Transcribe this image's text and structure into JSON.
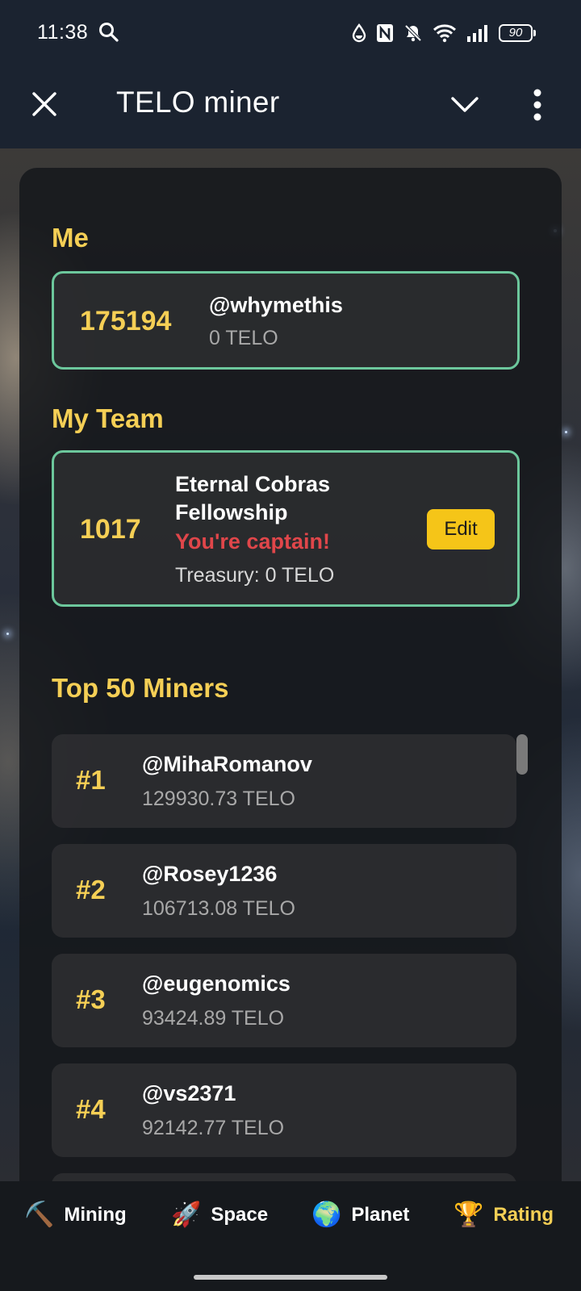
{
  "status_bar": {
    "time": "11:38",
    "battery": "90"
  },
  "header": {
    "title": "TELO miner"
  },
  "me": {
    "section_title": "Me",
    "rank": "175194",
    "username": "@whymethis",
    "balance": "0 TELO"
  },
  "team": {
    "section_title": "My Team",
    "rank": "1017",
    "name_line1": "Eternal Cobras",
    "name_line2": "Fellowship",
    "captain_text": "You're captain!",
    "treasury": "Treasury: 0 TELO",
    "edit_label": "Edit"
  },
  "top": {
    "section_title": "Top 50 Miners",
    "items": [
      {
        "rank": "#1",
        "name": "@MihaRomanov",
        "value": "129930.73 TELO"
      },
      {
        "rank": "#2",
        "name": "@Rosey1236",
        "value": "106713.08 TELO"
      },
      {
        "rank": "#3",
        "name": "@eugenomics",
        "value": "93424.89 TELO"
      },
      {
        "rank": "#4",
        "name": "@vs2371",
        "value": "92142.77 TELO"
      }
    ]
  },
  "nav": {
    "items": [
      {
        "icon": "⛏️",
        "label": "Mining",
        "icon_name": "pickaxe-icon"
      },
      {
        "icon": "🚀",
        "label": "Space",
        "icon_name": "rocket-icon"
      },
      {
        "icon": "🌍",
        "label": "Planet",
        "icon_name": "globe-icon"
      },
      {
        "icon": "🏆",
        "label": "Rating",
        "icon_name": "trophy-icon"
      }
    ],
    "active": "Rating"
  },
  "colors": {
    "accent_gold": "#f5cf55",
    "card_border": "#6cc79c",
    "captain_red": "#e0464a",
    "edit_button": "#f5c518"
  }
}
